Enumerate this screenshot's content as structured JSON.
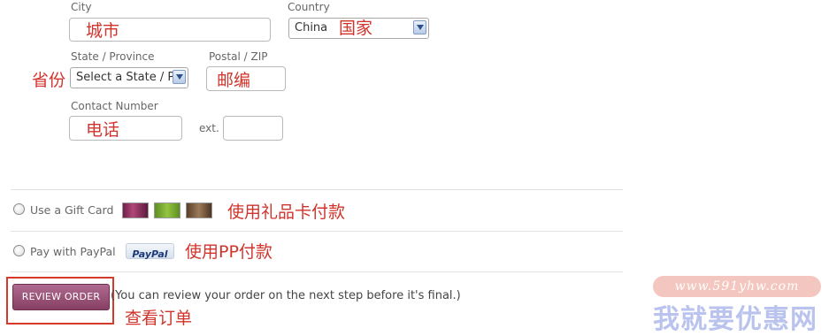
{
  "address": {
    "city_label": "City",
    "city_note": "城市",
    "country_label": "Country",
    "country_value": "China",
    "country_note": "国家",
    "state_label": "State / Province",
    "state_value": "Select a State / P",
    "state_note": "省份",
    "postal_label": "Postal / ZIP",
    "postal_note": "邮编",
    "contact_label": "Contact Number",
    "contact_note": "电话",
    "ext_label": "ext."
  },
  "payment": {
    "gift_card_label": "Use a Gift Card",
    "gift_card_note": "使用礼品卡付款",
    "gift_card_colors": [
      "#8a2a5a",
      "#7ab032",
      "#7a5a3a"
    ],
    "paypal_label": "Pay with PayPal",
    "paypal_logo": "PayPal",
    "paypal_note": "使用PP付款"
  },
  "review": {
    "button_label": "REVIEW ORDER",
    "hint": "(You can review your order on the next step before it's final.)",
    "note": "查看订单"
  },
  "watermark": {
    "url": "www.591yhw.com",
    "name": "我就要优惠网"
  },
  "colors": {
    "annotation": "#d0342c",
    "button": "#9a5277"
  }
}
